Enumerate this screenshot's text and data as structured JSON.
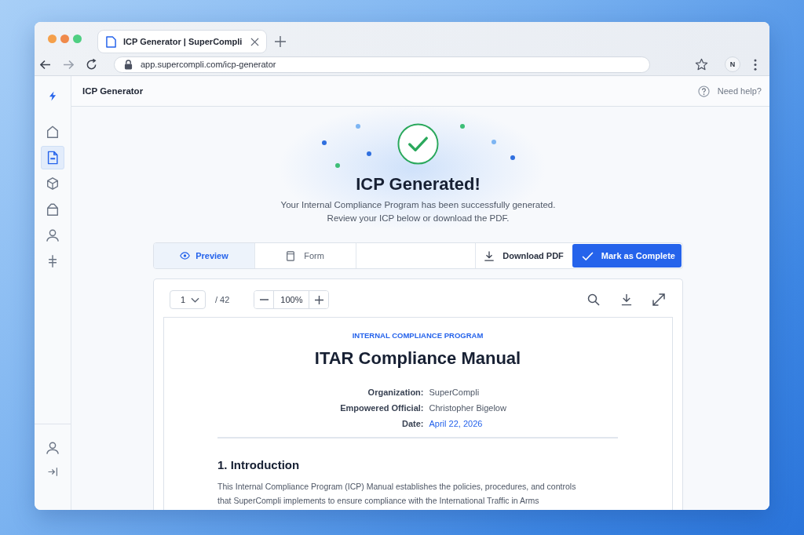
{
  "browser": {
    "tab_title": "ICP Generator | SuperCompli",
    "url": "app.supercompli.com/icp-generator",
    "profile_initial": "N"
  },
  "sidebar": {
    "nav_items": [
      {
        "selected": false
      },
      {
        "selected": true
      },
      {
        "selected": false
      },
      {
        "selected": false
      },
      {
        "selected": false
      },
      {
        "selected": false
      }
    ]
  },
  "header": {
    "title": "ICP Generator",
    "help_label": "Need help?"
  },
  "success": {
    "title": "ICP Generated!",
    "message": [
      "Your Internal Compliance Program has been successfully generated.",
      "Review your ICP below or download the PDF."
    ]
  },
  "view_tabs": [
    {
      "label": "Preview",
      "selected": true
    },
    {
      "label": "Form",
      "selected": false
    }
  ],
  "actions": [
    {
      "label": "Download PDF",
      "kind": "secondary"
    },
    {
      "label": "Mark as Complete",
      "kind": "primary"
    }
  ],
  "viewer": {
    "page": "1",
    "page_count": "/ 42",
    "zoom": "100%"
  },
  "document": {
    "eyebrow": "INTERNAL COMPLIANCE PROGRAM",
    "title": "ITAR Compliance Manual",
    "meta": [
      {
        "label": "Organization:",
        "value": "SuperCompli",
        "kind": "text"
      },
      {
        "label": "Empowered Official:",
        "value": "Christopher Bigelow",
        "kind": "text"
      },
      {
        "label": "Date:",
        "value": "April 22, 2026",
        "kind": "date"
      }
    ],
    "section_title": "1. Introduction",
    "paragraph": "This Internal Compliance Program (ICP) Manual establishes the policies, procedures, and controls that SuperCompli implements to ensure compliance with the International Traffic in Arms"
  }
}
